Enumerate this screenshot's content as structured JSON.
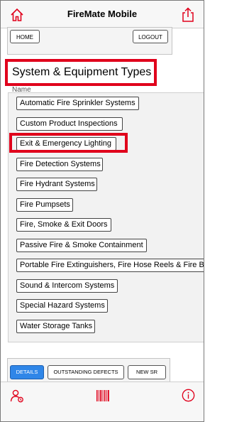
{
  "header": {
    "title": "FireMate Mobile"
  },
  "top_buttons": {
    "home_label": "HOME",
    "logout_label": "LOGOUT"
  },
  "section": {
    "title": "System & Equipment Types",
    "column_label": "Name"
  },
  "list_items": [
    "Automatic Fire Sprinkler Systems",
    "Custom Product Inspections",
    "Exit & Emergency Lighting",
    "Fire Detection Systems",
    "Fire Hydrant Systems",
    "Fire Pumpsets",
    "Fire, Smoke & Exit Doors",
    "Passive Fire & Smoke Containment",
    "Portable Fire Extinguishers, Fire Hose Reels & Fire B",
    "Sound & Intercom Systems",
    "Special Hazard Systems",
    "Water Storage Tanks"
  ],
  "bottom_tabs": {
    "details": "DETAILS",
    "defects": "OUTSTANDING DEFECTS",
    "new_sr": "NEW SR"
  },
  "colors": {
    "accent": "#e0001b",
    "active_tab": "#2f86e8"
  },
  "icons": {
    "home": "home-icon",
    "share": "share-icon",
    "user": "user-icon",
    "barcode": "barcode-icon",
    "info": "info-icon"
  }
}
